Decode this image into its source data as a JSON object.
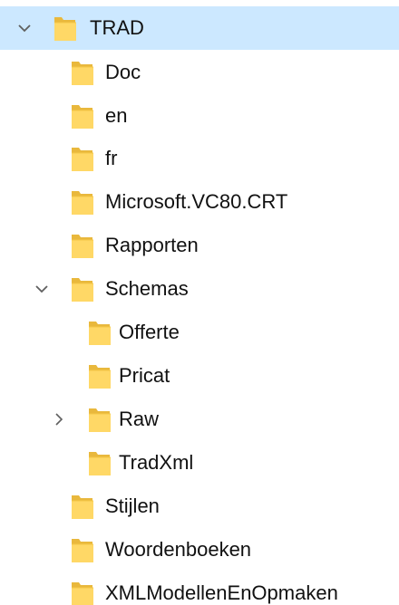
{
  "colors": {
    "selection": "#cce8ff",
    "folder_body": "#ffd866",
    "folder_back": "#e9b83c",
    "chevron": "#5f5f5f",
    "text": "#111111"
  },
  "tree": [
    {
      "label": "TRAD",
      "level": 0,
      "state": "expanded",
      "selected": true,
      "icon": "folder-icon"
    },
    {
      "label": "Doc",
      "level": 1,
      "state": "leaf",
      "icon": "folder-icon"
    },
    {
      "label": "en",
      "level": 1,
      "state": "leaf",
      "icon": "folder-icon"
    },
    {
      "label": "fr",
      "level": 1,
      "state": "leaf",
      "icon": "folder-icon"
    },
    {
      "label": "Microsoft.VC80.CRT",
      "level": 1,
      "state": "leaf",
      "icon": "folder-icon"
    },
    {
      "label": "Rapporten",
      "level": 1,
      "state": "leaf",
      "icon": "folder-icon"
    },
    {
      "label": "Schemas",
      "level": 1,
      "state": "expanded",
      "icon": "folder-icon"
    },
    {
      "label": "Offerte",
      "level": 2,
      "state": "leaf",
      "icon": "folder-icon"
    },
    {
      "label": "Pricat",
      "level": 2,
      "state": "leaf",
      "icon": "folder-icon"
    },
    {
      "label": "Raw",
      "level": 2,
      "state": "collapsed",
      "icon": "folder-icon"
    },
    {
      "label": "TradXml",
      "level": 2,
      "state": "leaf",
      "icon": "folder-icon"
    },
    {
      "label": "Stijlen",
      "level": 1,
      "state": "leaf",
      "icon": "folder-icon"
    },
    {
      "label": "Woordenboeken",
      "level": 1,
      "state": "leaf",
      "icon": "folder-icon"
    },
    {
      "label": "XMLModellenEnOpmaken",
      "level": 1,
      "state": "leaf",
      "icon": "folder-icon"
    }
  ]
}
